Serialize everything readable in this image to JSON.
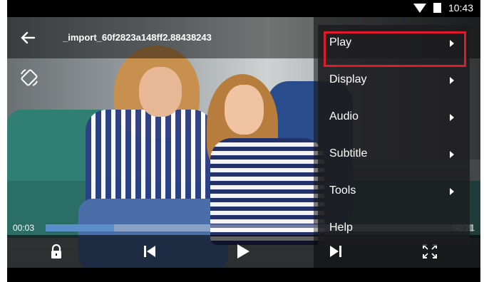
{
  "status_bar": {
    "time": "10:43"
  },
  "video": {
    "title": "_import_60f2823a148ff2.88438243",
    "current_time": "00:03",
    "total_time": "00:21",
    "progress_fraction": 0.16
  },
  "menu": {
    "items": [
      {
        "label": "Play"
      },
      {
        "label": "Display"
      },
      {
        "label": "Audio"
      },
      {
        "label": "Subtitle"
      },
      {
        "label": "Tools"
      },
      {
        "label": "Help"
      }
    ],
    "highlighted_index": 0
  },
  "colors": {
    "accent": "#5b8fc9",
    "highlight": "#e0192b"
  },
  "icons": [
    "wifi-icon",
    "battery-icon",
    "back-arrow-icon",
    "rotate-screen-icon",
    "lock-icon",
    "skip-previous-icon",
    "play-icon",
    "skip-next-icon",
    "fullscreen-icon"
  ]
}
